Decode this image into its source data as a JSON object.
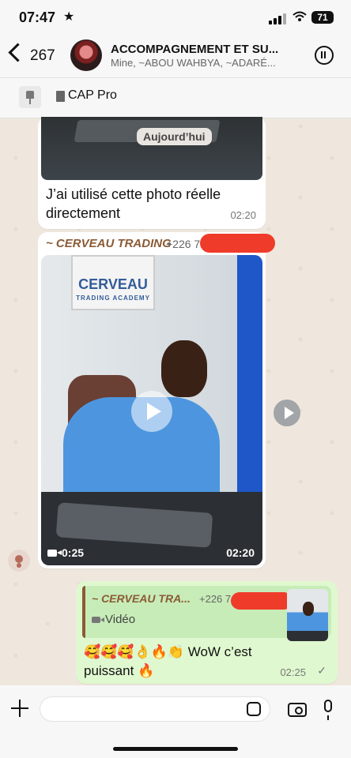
{
  "status": {
    "time": "07:47",
    "battery": "71"
  },
  "header": {
    "back_count": "267",
    "title": "ACCOMPAGNEMENT ET SU...",
    "subtitle": "Mine, ~ABOU WAHBYA, ~ADARÉ..."
  },
  "pinned": {
    "label": "CAP Pro"
  },
  "messages": [
    {
      "date_label": "Aujourd’hui",
      "text": "J’ai utilisé cette photo réelle directement",
      "time": "02:20"
    },
    {
      "sender": "~ CERVEAU TRADING",
      "phone": "+226 77",
      "video_duration": "0:25",
      "time": "02:20"
    },
    {
      "quote_sender": "~ CERVEAU TRA...",
      "quote_phone": "+226 7",
      "quote_type": "Vidéo",
      "text": "🥰🥰🥰👌🔥👏 WoW c’est puissant 🔥",
      "time": "02:25",
      "status": "✓"
    }
  ],
  "video_logo": {
    "title": "CERVEAU",
    "subtitle": "TRADING ACADEMY"
  },
  "input": {
    "placeholder": ""
  }
}
